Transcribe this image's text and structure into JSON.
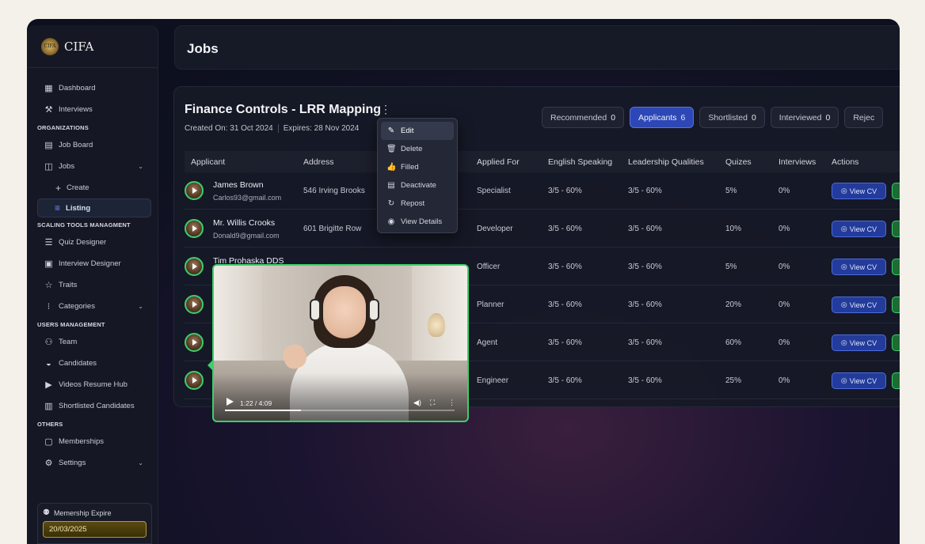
{
  "brand": {
    "name": "CIFA",
    "logo_text": "CIFA"
  },
  "sidebar": {
    "items": [
      {
        "label": "Dashboard",
        "icon": "dashboard-icon"
      },
      {
        "label": "Interviews",
        "icon": "hammer-icon"
      }
    ],
    "section_org": "ORGANIZATIONS",
    "org_items": [
      {
        "label": "Job Board",
        "icon": "board-icon"
      },
      {
        "label": "Jobs",
        "icon": "briefcase-icon"
      }
    ],
    "jobs_sub": [
      {
        "label": "Create",
        "icon": "plus-icon"
      },
      {
        "label": "Listing",
        "icon": "list-icon"
      }
    ],
    "section_scaling": "SCALING TOOLS MANAGMENT",
    "scaling_items": [
      {
        "label": "Quiz Designer"
      },
      {
        "label": "Interview Designer"
      },
      {
        "label": "Traits"
      },
      {
        "label": "Categories"
      }
    ],
    "section_users": "USERS MANAGEMENT",
    "users_items": [
      {
        "label": "Team"
      },
      {
        "label": "Candidates"
      },
      {
        "label": "Videos Resume Hub"
      },
      {
        "label": "Shortlisted Candidates"
      }
    ],
    "section_others": "OTHERS",
    "others_items": [
      {
        "label": "Memberships"
      },
      {
        "label": "Settings"
      }
    ],
    "membership": {
      "title": "Memership Expire",
      "date": "20/03/2025"
    }
  },
  "header": {
    "title": "Jobs"
  },
  "job": {
    "title": "Finance Controls - LRR Mapping",
    "created": "Created On: 31 Oct 2024",
    "expires": "Expires: 28 Nov 2024"
  },
  "tabs": [
    {
      "label": "Recommended",
      "count": "0"
    },
    {
      "label": "Applicants",
      "count": "6"
    },
    {
      "label": "Shortlisted",
      "count": "0"
    },
    {
      "label": "Interviewed",
      "count": "0"
    },
    {
      "label": "Rejec",
      "count": ""
    }
  ],
  "table": {
    "headers": [
      "Applicant",
      "Address",
      "Applied For",
      "English Speaking",
      "Leadership Qualities",
      "Quizes",
      "Interviews",
      "Actions"
    ],
    "view_cv_label": "View CV",
    "rows": [
      {
        "name": "James Brown",
        "email": "Carlos93@gmail.com",
        "address": "546 Irving Brooks",
        "applied": "Specialist",
        "english": "3/5 - 60%",
        "leadership": "3/5 - 60%",
        "quizes": "5%",
        "interviews": "0%"
      },
      {
        "name": "Mr. Willis Crooks",
        "email": "Donald9@gmail.com",
        "address": "601 Brigitte Row",
        "applied": "Developer",
        "english": "3/5 - 60%",
        "leadership": "3/5 - 60%",
        "quizes": "10%",
        "interviews": "0%"
      },
      {
        "name": "Tim Prohaska DDS",
        "email": "",
        "address": "",
        "applied": "Officer",
        "english": "3/5 - 60%",
        "leadership": "3/5 - 60%",
        "quizes": "5%",
        "interviews": "0%"
      },
      {
        "name": "",
        "email": "",
        "address": "",
        "applied": "Planner",
        "english": "3/5 - 60%",
        "leadership": "3/5 - 60%",
        "quizes": "20%",
        "interviews": "0%"
      },
      {
        "name": "",
        "email": "",
        "address": "",
        "applied": "Agent",
        "english": "3/5 - 60%",
        "leadership": "3/5 - 60%",
        "quizes": "60%",
        "interviews": "0%"
      },
      {
        "name": "",
        "email": "",
        "address": "",
        "applied": "Engineer",
        "english": "3/5 - 60%",
        "leadership": "3/5 - 60%",
        "quizes": "25%",
        "interviews": "0%"
      }
    ]
  },
  "menu": {
    "items": [
      {
        "label": "Edit",
        "icon": "edit-icon"
      },
      {
        "label": "Delete",
        "icon": "trash-icon"
      },
      {
        "label": "Filled",
        "icon": "thumbs-up-icon"
      },
      {
        "label": "Deactivate",
        "icon": "archive-icon"
      },
      {
        "label": "Repost",
        "icon": "repost-icon"
      },
      {
        "label": "View Details",
        "icon": "eye-icon"
      }
    ]
  },
  "video": {
    "time": "1:22 / 4:09",
    "progress": 0.33
  },
  "colors": {
    "accent": "#2d47b6",
    "green": "#3ccf6a",
    "gold": "#b89a2a"
  }
}
